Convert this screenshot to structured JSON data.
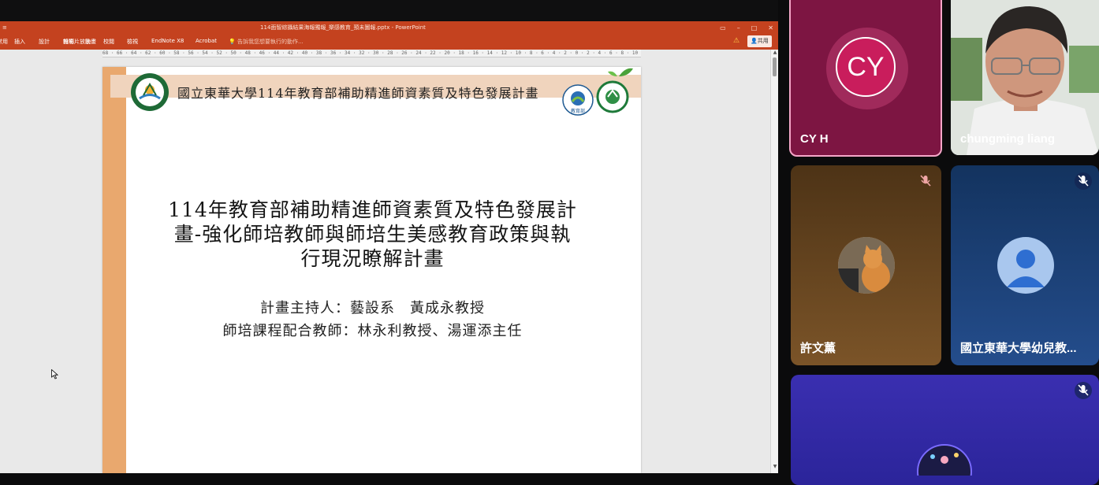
{
  "powerpoint": {
    "window_title": "114面智綜攝結果海報獨報_樂感教育_預未圖報.pptx - PowerPoint",
    "window_controls": [
      "▭",
      "–",
      "□",
      "✕"
    ],
    "ribbon_tabs": [
      "常用",
      "插入",
      "設計",
      "轉場",
      "動畫",
      "投影片放映",
      "校閱",
      "檢視",
      "EndNote X8",
      "Acrobat"
    ],
    "tell_me": "告訴我您想要執行的動作...",
    "share_label": "共用",
    "ruler_text": "68 · 66 · 64 · 62 · 60 · 58 · 56 · 54 · 52 · 50 · 48 · 46 · 44 · 42 · 40 · 38 · 36 · 34 · 32 · 30 · 28 · 26 · 24 · 22 · 20 · 18 · 16 · 14 · 12 · 10 · 8 · 6 · 4 · 2 · 0 · 2 · 4 · 6 · 8 · 10 · 12 · 14 · 16 · 18 · 20 · 22 · 24 · 26 · 28 · 30 · 32 · 34 · 36 · 38 · 40 · 42 · 44 · 46 · 48 · 50 · 52 · 54 · 56 · 58 · 60 · 62 · 64 · 66 · 68"
  },
  "slide": {
    "header_title": "國立東華大學114年教育部補助精進師資素質及特色發展計畫",
    "main_title_lines": [
      "114年教育部補助精進師資素質及特色發展計",
      "畫-強化師培教師與師培生美感教育政策與執",
      "行現況瞭解計畫"
    ],
    "host": "計畫主持人：藝設系　黃成永教授",
    "co_teachers": "師培課程配合教師：林永利教授、湯運添主任",
    "moe_logo_text": "教育部",
    "colors": {
      "left_bar": "#e9a86e",
      "header_band": "#f0d4bd"
    }
  },
  "meet": {
    "tiles": [
      {
        "id": "cyh",
        "initials": "CY",
        "name": "CY H"
      },
      {
        "id": "chungming",
        "name": "chungming liang"
      },
      {
        "id": "xu",
        "name": "許文薰",
        "muted": true
      },
      {
        "id": "dhu",
        "name": "國立東華大學幼兒教...",
        "muted": true
      },
      {
        "id": "bottom",
        "name": "",
        "muted": true
      }
    ],
    "colors": {
      "speaker_border": "#f5a6c8",
      "cy_avatar": "#c91d5c"
    }
  }
}
